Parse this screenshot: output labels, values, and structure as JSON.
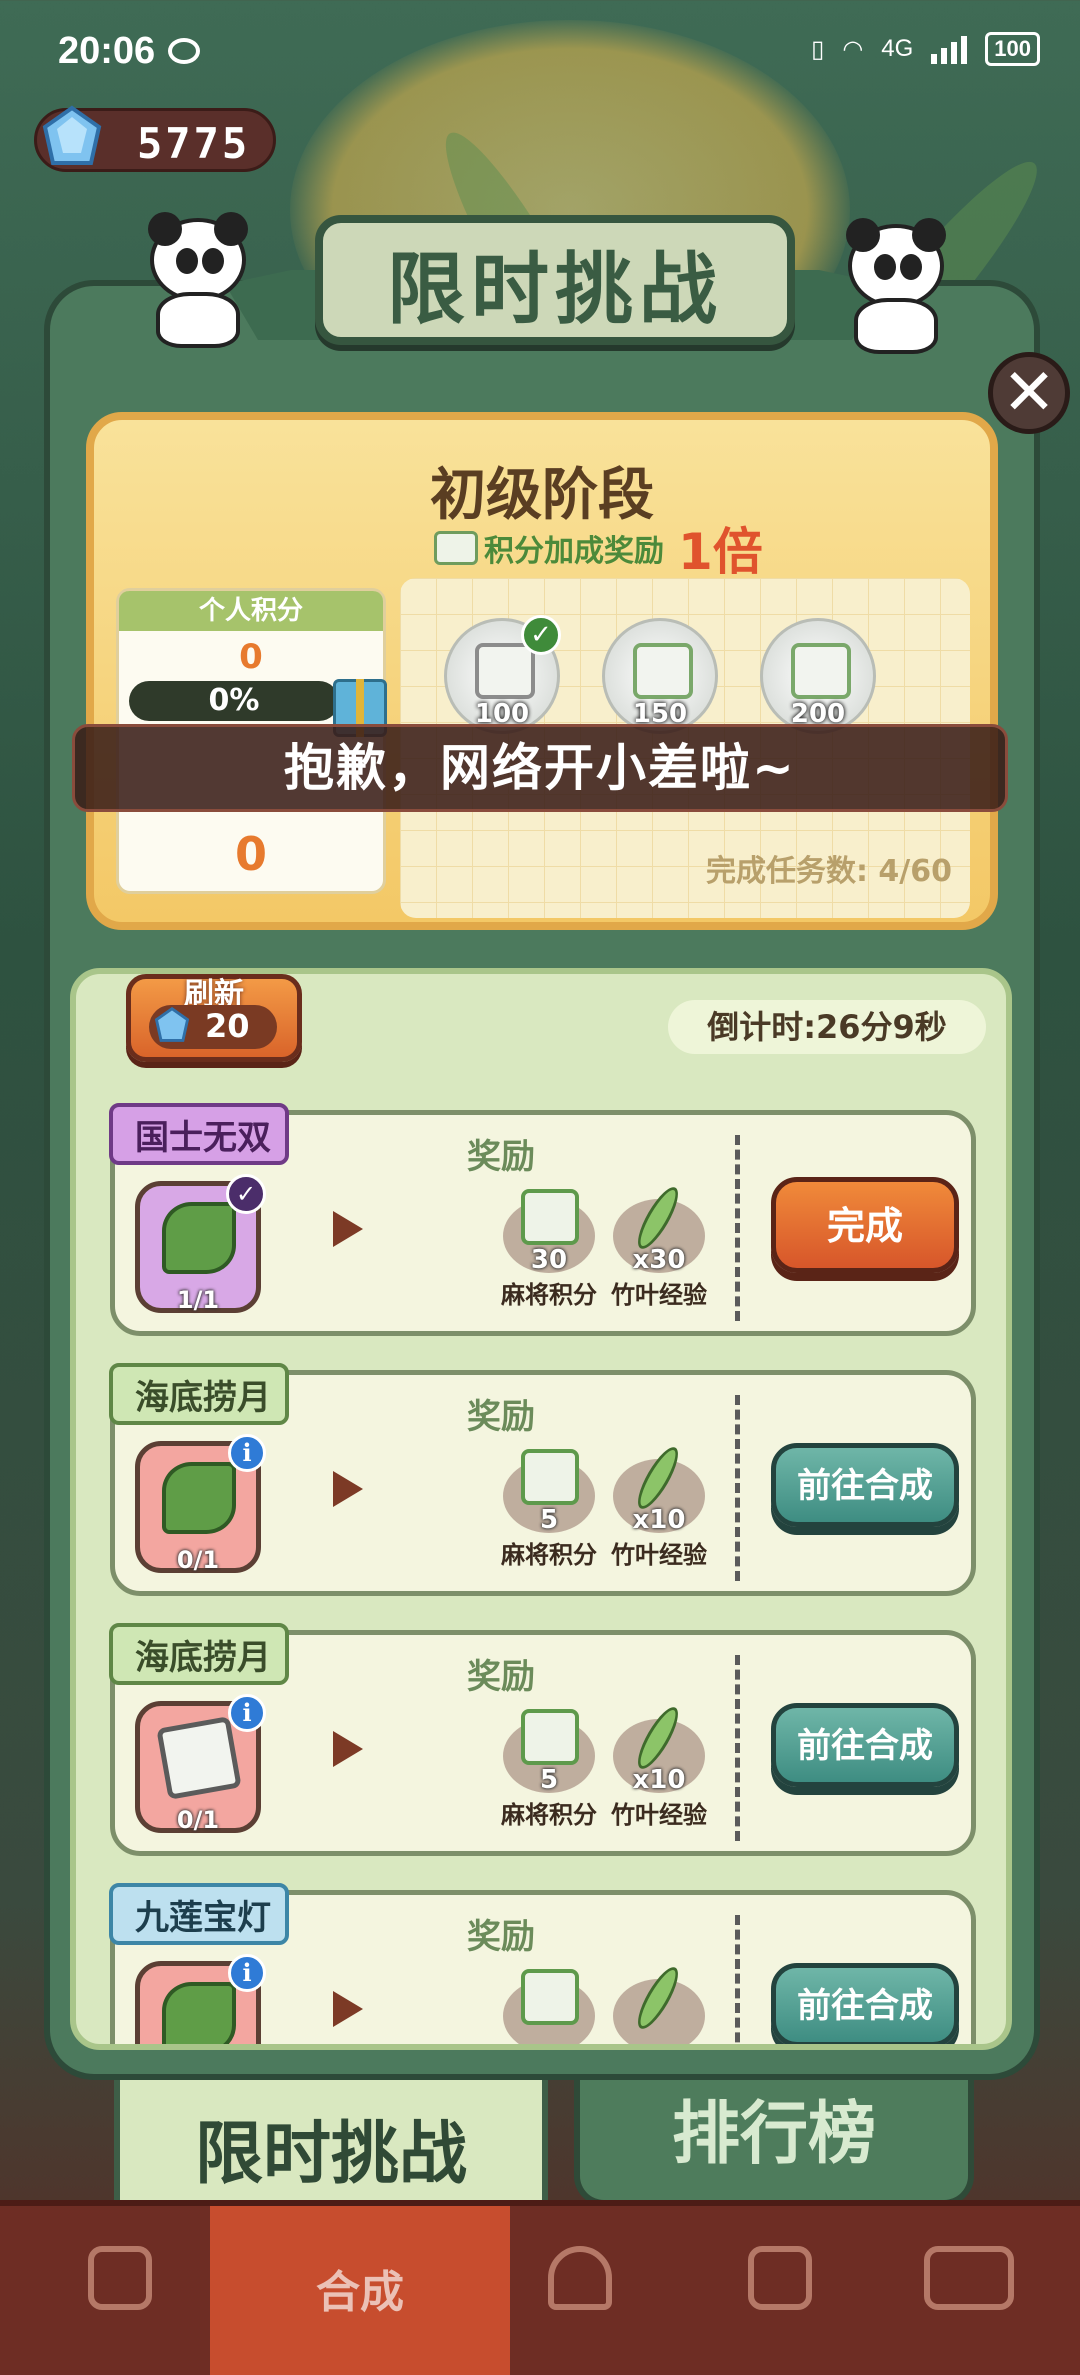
{
  "status_bar": {
    "time": "20:06",
    "network": "4G",
    "battery": "100"
  },
  "currency": {
    "gems": "5775"
  },
  "banner": {
    "title": "限时挑战"
  },
  "stage": {
    "title": "初级阶段",
    "bonus_text": "积分加成奖励",
    "bonus_multiplier": "1倍",
    "personal_score_label": "个人积分",
    "personal_score": "0",
    "progress": "0%",
    "rank_score": "0",
    "milestones": [
      {
        "value": "100",
        "completed": true
      },
      {
        "value": "150",
        "completed": false
      },
      {
        "value": "200",
        "completed": false
      }
    ],
    "tasks_done_label": "完成任务数: 4/60"
  },
  "toast": {
    "message": "抱歉，网络开小差啦~"
  },
  "task_panel": {
    "refresh_label": "刷新",
    "refresh_cost": "20",
    "countdown": "倒计时:26分9秒",
    "reward_label": "奖励",
    "tasks": [
      {
        "name": "国士无双",
        "progress": "1/1",
        "reward1_value": "30",
        "reward1_name": "麻将积分",
        "reward2_value": "x30",
        "reward2_name": "竹叶经验",
        "button": "完成"
      },
      {
        "name": "海底捞月",
        "progress": "0/1",
        "reward1_value": "5",
        "reward1_name": "麻将积分",
        "reward2_value": "x10",
        "reward2_name": "竹叶经验",
        "button": "前往合成"
      },
      {
        "name": "海底捞月",
        "progress": "0/1",
        "reward1_value": "5",
        "reward1_name": "麻将积分",
        "reward2_value": "x10",
        "reward2_name": "竹叶经验",
        "button": "前往合成"
      },
      {
        "name": "九莲宝灯",
        "progress": "",
        "button": "前往合成"
      }
    ]
  },
  "tabs": {
    "active": "限时挑战",
    "inactive": "排行榜"
  },
  "bottom_nav": {
    "merge_label": "合成"
  },
  "colors": {
    "panel_green": "#4c7a5d",
    "orange_button": "#d7562a",
    "teal_button": "#3e8d82",
    "score_orange": "#e77a2e"
  }
}
